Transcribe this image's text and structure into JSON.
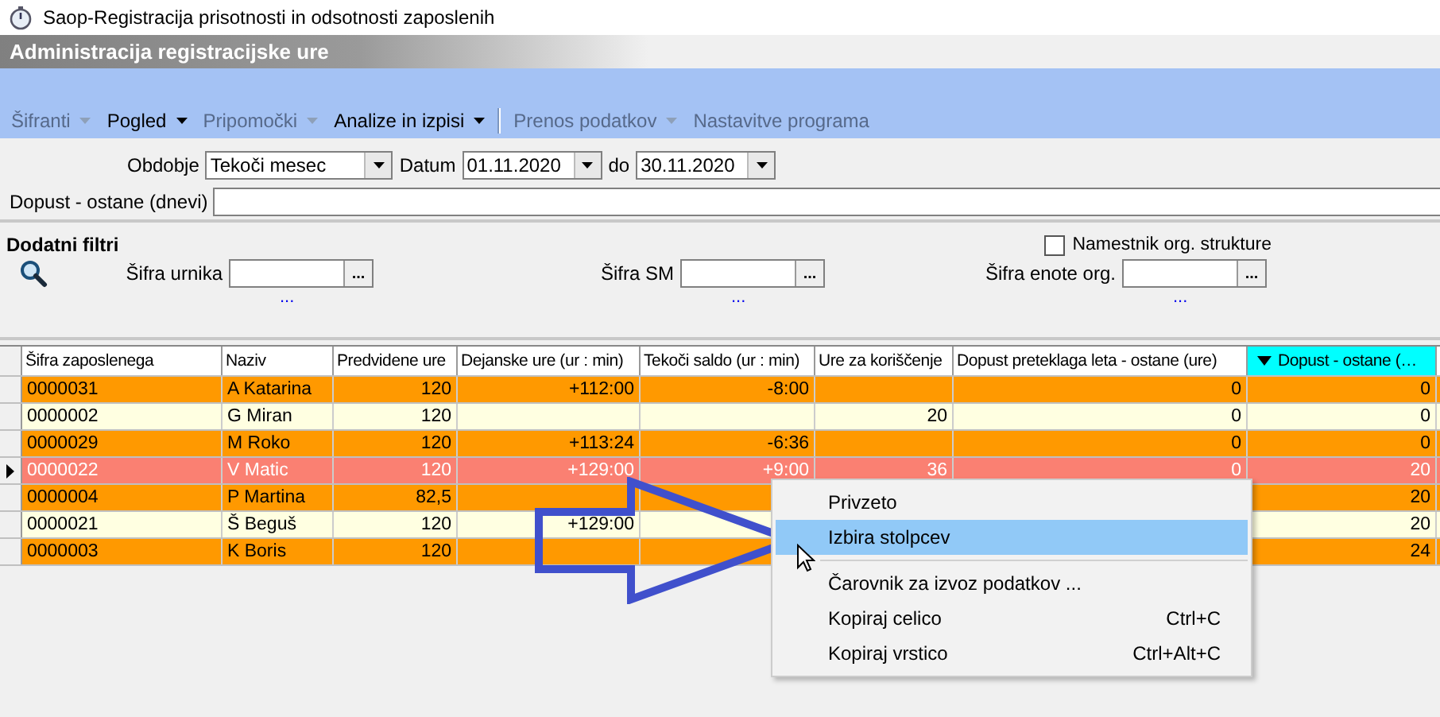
{
  "window": {
    "title": "Saop-Registracija prisotnosti in odsotnosti zaposlenih"
  },
  "module_title": "Administracija registracijske ure",
  "menu": [
    {
      "kind": "menu",
      "label": "Šifranti",
      "disabled": true,
      "dropdown": true
    },
    {
      "kind": "menu",
      "label": "Pogled",
      "disabled": false,
      "dropdown": true
    },
    {
      "kind": "menu",
      "label": "Pripomočki",
      "disabled": true,
      "dropdown": true
    },
    {
      "kind": "menu",
      "label": "Analize in izpisi",
      "disabled": false,
      "dropdown": true
    },
    {
      "kind": "separator"
    },
    {
      "kind": "menu",
      "label": "Prenos podatkov",
      "disabled": true,
      "dropdown": true
    },
    {
      "kind": "menu",
      "label": "Nastavitve programa",
      "disabled": true,
      "dropdown": false
    }
  ],
  "period": {
    "label": "Obdobje",
    "value": "Tekoči mesec"
  },
  "date_from": {
    "label": "Datum",
    "value": "01.11.2020"
  },
  "date_to": {
    "label": "do",
    "value": "30.11.2020"
  },
  "leave_remaining": {
    "label": "Dopust - ostane (dnevi)"
  },
  "extra_filters": {
    "title": "Dodatni filtri",
    "substitute": {
      "label": "Namestnik org. strukture",
      "checked": false
    },
    "lookups": [
      {
        "label": "Šifra urnika",
        "button": "...",
        "link": "..."
      },
      {
        "label": "Šifra SM",
        "button": "...",
        "link": "..."
      },
      {
        "label": "Šifra enote org.",
        "button": "...",
        "link": "..."
      }
    ]
  },
  "table": {
    "columns": [
      {
        "label": "Šifra zaposlenega",
        "sorted": false
      },
      {
        "label": "Naziv",
        "sorted": false
      },
      {
        "label": "Predvidene ure",
        "sorted": false
      },
      {
        "label": "Dejanske ure (ur : min)",
        "sorted": false
      },
      {
        "label": "Tekoči saldo (ur : min)",
        "sorted": false
      },
      {
        "label": "Ure za koriščenje",
        "sorted": false
      },
      {
        "label": "Dopust preteklaga leta - ostane (ure)",
        "sorted": false
      },
      {
        "label": "Dopust - ostane (…",
        "sorted": true
      }
    ],
    "rows": [
      {
        "selected": false,
        "color": "#ff9900",
        "cells": [
          "0000031",
          "A Katarina",
          "120",
          "+112:00",
          "-8:00",
          null,
          "0",
          "0"
        ]
      },
      {
        "selected": false,
        "color": "#ffffe1",
        "cells": [
          "0000002",
          "G Miran",
          "120",
          null,
          null,
          "20",
          "0",
          "0"
        ]
      },
      {
        "selected": false,
        "color": "#ff9900",
        "cells": [
          "0000029",
          "M Roko",
          "120",
          "+113:24",
          "-6:36",
          null,
          "0",
          "0"
        ]
      },
      {
        "selected": true,
        "color": "#fa8072",
        "cells": [
          "0000022",
          "V Matic",
          "120",
          "+129:00",
          "+9:00",
          "36",
          "0",
          "20"
        ]
      },
      {
        "selected": false,
        "color": "#ff9900",
        "cells": [
          "0000004",
          "P Martina",
          "82,5",
          null,
          null,
          null,
          null,
          "20"
        ]
      },
      {
        "selected": false,
        "color": "#ffffe1",
        "cells": [
          "0000021",
          "Š Beguš",
          "120",
          "+129:00",
          null,
          null,
          null,
          "20"
        ]
      },
      {
        "selected": false,
        "color": "#ff9900",
        "cells": [
          "0000003",
          "K Boris",
          "120",
          null,
          null,
          null,
          null,
          "24"
        ]
      }
    ]
  },
  "context_menu": [
    {
      "kind": "item",
      "label": "Privzeto",
      "selected": false
    },
    {
      "kind": "item",
      "label": "Izbira stolpcev",
      "selected": true
    },
    {
      "kind": "separator"
    },
    {
      "kind": "item",
      "label": "Čarovnik za izvoz podatkov ...",
      "selected": false
    },
    {
      "kind": "item",
      "label": "Kopiraj celico",
      "shortcut": "Ctrl+C",
      "selected": false
    },
    {
      "kind": "item",
      "label": "Kopiraj vrstico",
      "shortcut": "Ctrl+Alt+C",
      "selected": false
    }
  ]
}
